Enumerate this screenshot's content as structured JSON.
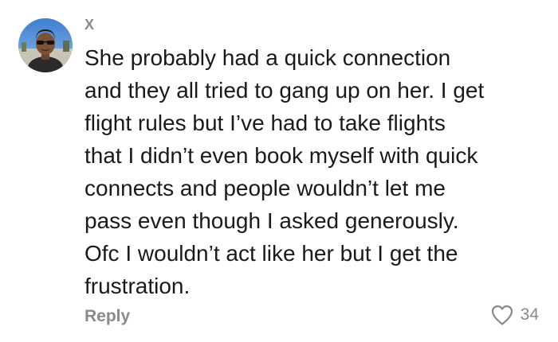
{
  "comment": {
    "username": "X",
    "text": "She probably had a quick connection\nand they all tried to gang up on her. I get\nflight rules but I’ve had to take flights\nthat I didn’t even book myself with quick\nconnects and people wouldn’t let me\npass even though I asked generously.\nOfc I wouldn’t act like her but I get the\nfrustration.",
    "reply_label": "Reply",
    "like_count": "34",
    "like_icon": "heart-outline-icon"
  },
  "colors": {
    "meta_gray": "#8a8a8a",
    "text": "#1a1a1a",
    "background": "#ffffff"
  }
}
